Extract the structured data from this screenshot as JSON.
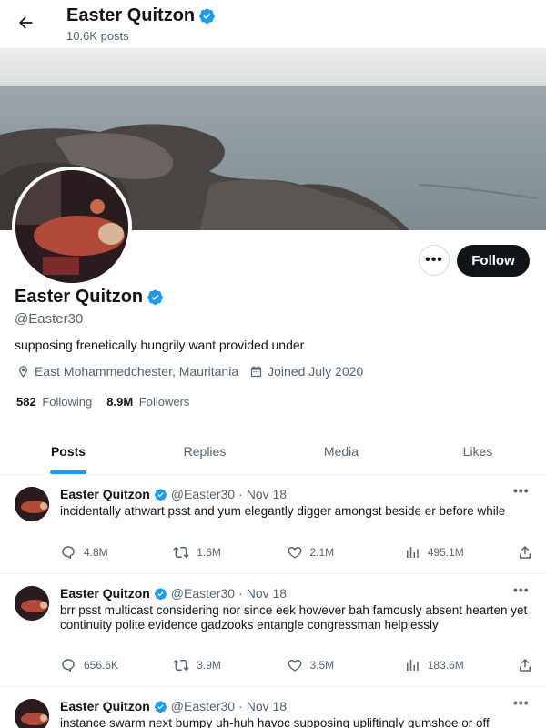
{
  "header": {
    "name": "Easter Quitzon",
    "post_count": "10.6K posts"
  },
  "profile": {
    "name": "Easter Quitzon",
    "handle": "@Easter30",
    "bio": "supposing frenetically hungrily want provided under",
    "location": "East Mohammedchester, Mauritania",
    "joined": "Joined July 2020",
    "following_count": "582",
    "following_label": "Following",
    "followers_count": "8.9M",
    "followers_label": "Followers",
    "follow_label": "Follow",
    "more_label": "•••"
  },
  "tabs": [
    {
      "label": "Posts",
      "active": true
    },
    {
      "label": "Replies",
      "active": false
    },
    {
      "label": "Media",
      "active": false
    },
    {
      "label": "Likes",
      "active": false
    }
  ],
  "tweets": [
    {
      "name": "Easter Quitzon",
      "handle": "@Easter30",
      "date": "Nov 18",
      "text": "incidentally athwart psst and yum elegantly digger amongst beside er before while",
      "replies": "4.8M",
      "retweets": "1.6M",
      "likes": "2.1M",
      "views": "495.1M"
    },
    {
      "name": "Easter Quitzon",
      "handle": "@Easter30",
      "date": "Nov 18",
      "text": "brr psst multicast considering nor since eek however bah famously absent hearten yet continuity polite evidence gadzooks entangle congressman helplessly",
      "replies": "656.6K",
      "retweets": "3.9M",
      "likes": "3.5M",
      "views": "183.6M"
    },
    {
      "name": "Easter Quitzon",
      "handle": "@Easter30",
      "date": "Nov 18",
      "text": "instance swarm next bumpy uh-huh havoc supposing upliftingly gumshoe or off"
    }
  ],
  "colors": {
    "accent": "#1d9bf0",
    "text": "#0f1419",
    "muted": "#536471"
  }
}
